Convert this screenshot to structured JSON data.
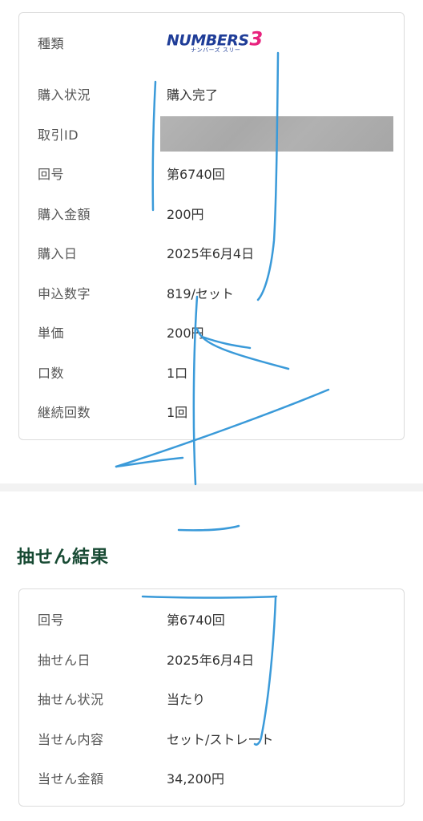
{
  "purchase_details": {
    "type": {
      "label": "種類",
      "logo_text": "NUMBERS",
      "logo_number": "3",
      "logo_subtext": "ナンバーズ スリー"
    },
    "status": {
      "label": "購入状況",
      "value": "購入完了"
    },
    "transaction_id": {
      "label": "取引ID",
      "value": ""
    },
    "round": {
      "label": "回号",
      "value": "第6740回"
    },
    "amount": {
      "label": "購入金額",
      "value": "200円"
    },
    "date": {
      "label": "購入日",
      "value": "2025年6月4日"
    },
    "numbers": {
      "label": "申込数字",
      "value": "819/セット"
    },
    "unit_price": {
      "label": "単価",
      "value": "200円"
    },
    "units": {
      "label": "口数",
      "value": "1口"
    },
    "continuation": {
      "label": "継続回数",
      "value": "1回"
    }
  },
  "draw_result": {
    "title": "抽せん結果",
    "round": {
      "label": "回号",
      "value": "第6740回"
    },
    "draw_date": {
      "label": "抽せん日",
      "value": "2025年6月4日"
    },
    "draw_status": {
      "label": "抽せん状況",
      "value": "当たり"
    },
    "win_type": {
      "label": "当せん内容",
      "value": "セット/ストレート"
    },
    "win_amount": {
      "label": "当せん金額",
      "value": "34,200円"
    }
  },
  "colors": {
    "logo_blue": "#1f3d98",
    "logo_pink": "#e8237e",
    "section_title": "#174a33",
    "scribble": "#3a9ad9"
  }
}
